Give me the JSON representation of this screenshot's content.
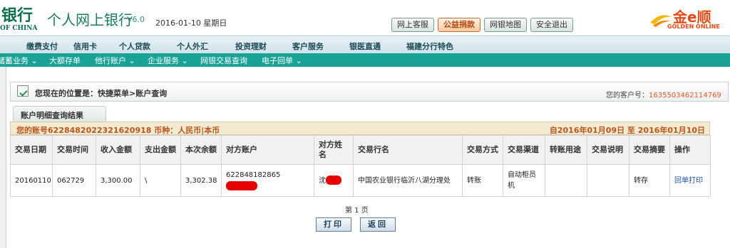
{
  "header": {
    "logo_cn": "银行",
    "logo_en": "OF CHINA",
    "title": "个人网上银行",
    "version": "V6.0",
    "date": "2016-01-10 星期日",
    "buttons": [
      "网上客服",
      "公益捐款",
      "网银地图",
      "安全退出"
    ],
    "highlight_button_index": 1,
    "brand_cn": "金e顺",
    "brand_en": "GOLDEN ONLINE"
  },
  "nav_primary": [
    "缴费支付",
    "信用卡",
    "个人贷款",
    "个人外汇",
    "投资理财",
    "客户服务",
    "银医直通",
    "福建分行特色"
  ],
  "nav_secondary": [
    "储蓄业务 ⌄",
    "大额存单",
    "他行账户 ⌄",
    "企业服务 ⌄",
    "网银交易查询",
    "电子回单 ⌄"
  ],
  "location": {
    "text": "您现在的位置是：快捷菜单>账户查询",
    "customer_label": "您的客户号：",
    "customer_no": "1635503462114769"
  },
  "result_tab": "账户明细查询结果",
  "account_info": "您的账号6228482022321620918 币种：人民币|本币",
  "date_range": "自2016年01月09日 至 2016年01月10日",
  "table": {
    "headers": [
      "交易日期",
      "交易时间",
      "收入金额",
      "支出金额",
      "本次余额",
      "对方账户",
      "对方姓名",
      "交易行名",
      "交易方式",
      "交易渠道",
      "转账用途",
      "交易说明",
      "交易摘要",
      "操作"
    ],
    "row": {
      "date": "20160110",
      "time": "062729",
      "income": "3,300.00",
      "expense": "\\",
      "balance": "3,302.38",
      "counter_account": "622848182865",
      "counter_name": "沈",
      "bank_name": "中国农业银行临沂八湖分理处",
      "method": "转账",
      "channel": "自动柜员机",
      "purpose": "",
      "desc": "",
      "summary": "转存",
      "action": "回单打印"
    }
  },
  "page_label": "第 1 页",
  "buttons": {
    "print": "打印",
    "back": "返回"
  },
  "colors": {
    "brand_green": "#0c6e4c",
    "nav_teal": "#1aa297",
    "accent_orange": "#b8561b",
    "redaction": "#e60000"
  }
}
